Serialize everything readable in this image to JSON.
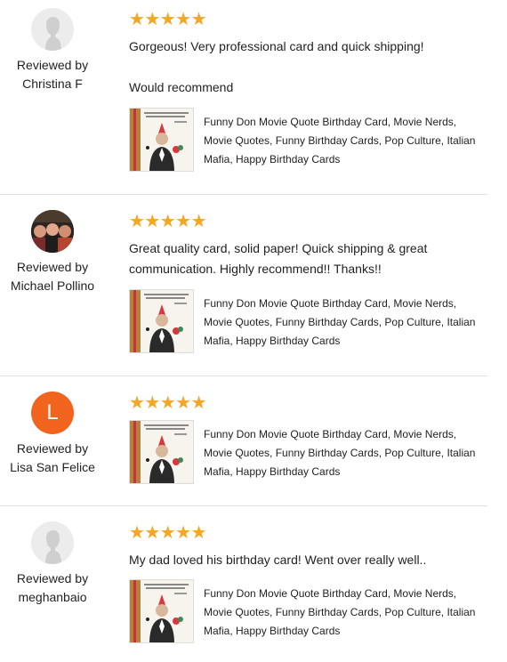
{
  "reviewed_by_label": "Reviewed by",
  "star_glyph": "★",
  "star_color": "#f5a623",
  "reviews": [
    {
      "reviewer": "Christina F",
      "avatar": "default",
      "rating": 5,
      "text_line1": "Gorgeous! Very professional card and quick shipping!",
      "text_line2": "Would recommend",
      "listing_title": "Funny Don Movie Quote Birthday Card, Movie Nerds, Movie Quotes, Funny Birthday Cards, Pop Culture, Italian Mafia, Happy Birthday Cards"
    },
    {
      "reviewer": "Michael Pollino",
      "avatar": "photo",
      "rating": 5,
      "text_line1": "Great quality card, solid paper! Quick shipping & great communication. Highly recommend!! Thanks!!",
      "listing_title": "Funny Don Movie Quote Birthday Card, Movie Nerds, Movie Quotes, Funny Birthday Cards, Pop Culture, Italian Mafia, Happy Birthday Cards"
    },
    {
      "reviewer": "Lisa San Felice",
      "avatar": "letter",
      "avatar_letter": "L",
      "avatar_color": "#f1641e",
      "rating": 5,
      "listing_title": "Funny Don Movie Quote Birthday Card, Movie Nerds, Movie Quotes, Funny Birthday Cards, Pop Culture, Italian Mafia, Happy Birthday Cards"
    },
    {
      "reviewer": "meghanbaio",
      "avatar": "default",
      "rating": 5,
      "text_line1": "My dad loved his birthday card! Went over really well..",
      "listing_title": "Funny Don Movie Quote Birthday Card, Movie Nerds, Movie Quotes, Funny Birthday Cards, Pop Culture, Italian Mafia, Happy Birthday Cards"
    }
  ]
}
